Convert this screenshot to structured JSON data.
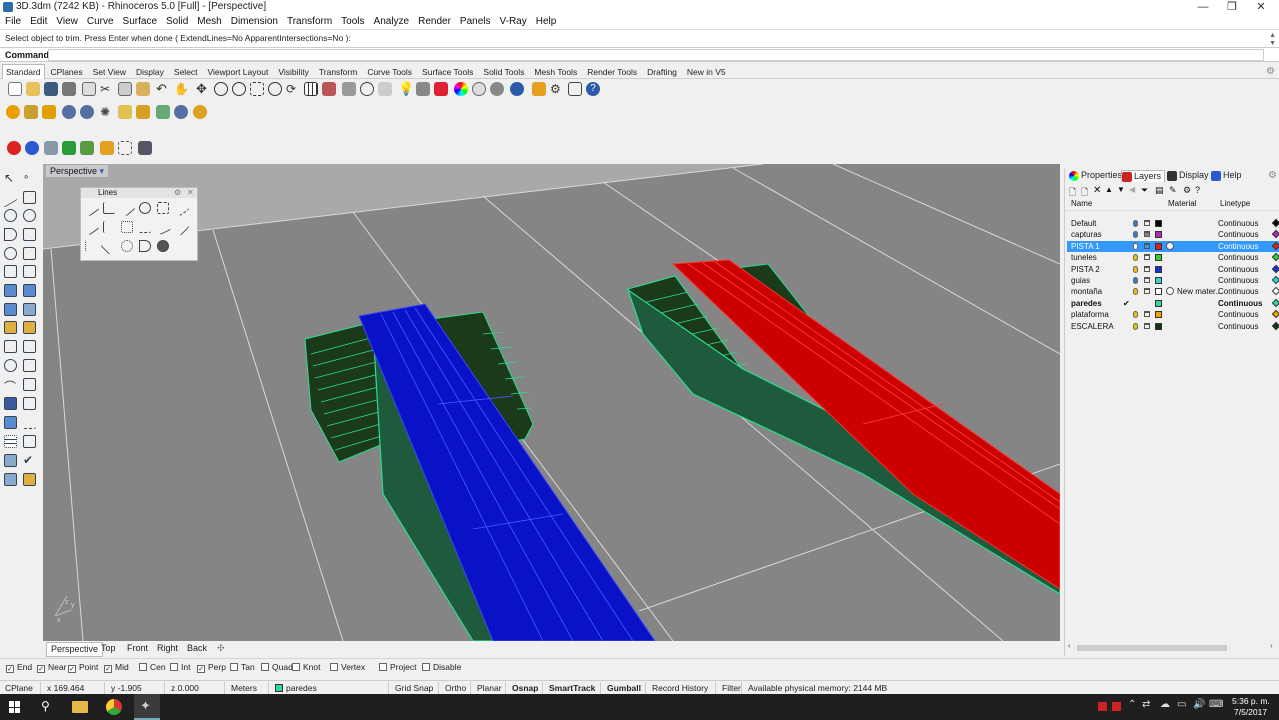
{
  "window": {
    "title": "3D.3dm (7242 KB) - Rhinoceros 5.0 [Full] - [Perspective]",
    "minimize": "—",
    "maximize": "❐",
    "close": "✕"
  },
  "menu": [
    "File",
    "Edit",
    "View",
    "Curve",
    "Surface",
    "Solid",
    "Mesh",
    "Dimension",
    "Transform",
    "Tools",
    "Analyze",
    "Render",
    "Panels",
    "V-Ray",
    "Help"
  ],
  "command": {
    "history": "Select object to trim. Press Enter when done ( ExtendLines=No  ApparentIntersections=No ):",
    "label": "Command:",
    "value": ""
  },
  "toolbar_tabs": [
    "Standard",
    "CPlanes",
    "Set View",
    "Display",
    "Select",
    "Viewport Layout",
    "Visibility",
    "Transform",
    "Curve Tools",
    "Surface Tools",
    "Solid Tools",
    "Mesh Tools",
    "Render Tools",
    "Drafting",
    "New in V5"
  ],
  "viewport": {
    "label": "Perspective",
    "tabs": [
      "Perspective",
      "Top",
      "Front",
      "Right",
      "Back"
    ],
    "add_tab_icon": "plus-icon",
    "axis_labels": [
      "z",
      "y",
      "x"
    ]
  },
  "lines_panel": {
    "title": "Lines",
    "gear_icon": "gear-icon",
    "close": "✕"
  },
  "right_panel": {
    "tabs": [
      "Properties",
      "Layers",
      "Display",
      "Help"
    ],
    "columns": {
      "name": "Name",
      "material": "Material",
      "linetype": "Linetype"
    },
    "layers": [
      {
        "name": "Default",
        "color": "#000000",
        "bulb": "#2a7fd4",
        "lock": "open",
        "material": "",
        "linetype": "Continuous",
        "bold": false,
        "selected": false
      },
      {
        "name": "capturas",
        "color": "#b02ab5",
        "bulb": "#2a7fd4",
        "lock": "closed",
        "material": "",
        "linetype": "Continuous",
        "bold": false,
        "selected": false
      },
      {
        "name": "PISTA 1",
        "color": "#e02020",
        "bulb": "#ffffff",
        "lock": "open",
        "material": "",
        "linetype": "Continuous",
        "bold": false,
        "selected": true
      },
      {
        "name": "tuneles",
        "color": "#33cc33",
        "bulb": "#f2c200",
        "lock": "open",
        "material": "",
        "linetype": "Continuous",
        "bold": false,
        "selected": false
      },
      {
        "name": "PISTA 2",
        "color": "#1a2fd4",
        "bulb": "#f2c200",
        "lock": "open",
        "material": "",
        "linetype": "Continuous",
        "bold": false,
        "selected": false
      },
      {
        "name": "guias",
        "color": "#33d6c8",
        "bulb": "#2a7fd4",
        "lock": "open",
        "material": "",
        "linetype": "Continuous",
        "bold": false,
        "selected": false
      },
      {
        "name": "montaña",
        "color": "#ffffff",
        "bulb": "#f2c200",
        "lock": "open",
        "material": "New mater...",
        "linetype": "Continuous",
        "bold": false,
        "selected": false
      },
      {
        "name": "paredes",
        "color": "#33d6a0",
        "bulb": "",
        "lock": "",
        "material": "",
        "linetype": "Continuous",
        "bold": true,
        "selected": false,
        "check": "✔"
      },
      {
        "name": "plataforma",
        "color": "#f2a500",
        "bulb": "#f2c200",
        "lock": "open",
        "material": "",
        "linetype": "Continuous",
        "bold": false,
        "selected": false
      },
      {
        "name": "ESCALERA",
        "color": "#0a3a0a",
        "bulb": "#f2c200",
        "lock": "open",
        "material": "",
        "linetype": "Continuous",
        "bold": false,
        "selected": false
      }
    ]
  },
  "osnap": [
    {
      "label": "End",
      "checked": true
    },
    {
      "label": "Near",
      "checked": true
    },
    {
      "label": "Point",
      "checked": true
    },
    {
      "label": "Mid",
      "checked": true
    },
    {
      "label": "Cen",
      "checked": false
    },
    {
      "label": "Int",
      "checked": false
    },
    {
      "label": "Perp",
      "checked": true
    },
    {
      "label": "Tan",
      "checked": false
    },
    {
      "label": "Quad",
      "checked": false
    },
    {
      "label": "Knot",
      "checked": false
    },
    {
      "label": "Vertex",
      "checked": false
    },
    {
      "label": "Project",
      "checked": false
    },
    {
      "label": "Disable",
      "checked": false
    }
  ],
  "status": {
    "cplane": "CPlane",
    "x": "x 169.464",
    "y": "y -1.905",
    "z": "z 0.000",
    "units": "Meters",
    "layer": "paredes",
    "layer_color": "#33d6a0",
    "buttons": [
      "Grid Snap",
      "Ortho",
      "Planar",
      "Osnap",
      "SmartTrack",
      "Gumball",
      "Record History",
      "Filter"
    ],
    "memory": "Available physical memory: 2144 MB"
  },
  "taskbar": {
    "time": "5:36 p. m.",
    "date": "7/5/2017"
  },
  "colors": {
    "pista1": "#e01010",
    "pista2": "#0a10c8",
    "walls": "#1f6040",
    "edges": "#34e6a0",
    "ground": "#858585",
    "sky": "#a9a9a9"
  }
}
